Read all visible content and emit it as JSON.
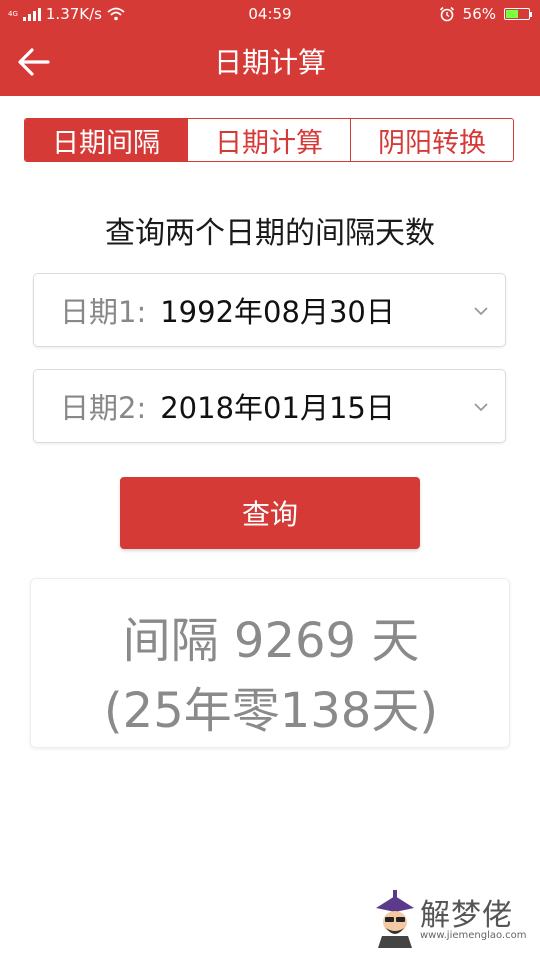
{
  "status_bar": {
    "network": "4G",
    "speed": "1.37K/s",
    "time": "04:59",
    "battery_percent": "56%",
    "battery_level": 0.56,
    "icons": [
      "signal-icon",
      "wifi-icon",
      "alarm-icon",
      "battery-icon"
    ]
  },
  "header": {
    "title": "日期计算",
    "back_icon": "arrow-left-icon"
  },
  "tabs": [
    {
      "label": "日期间隔",
      "active": true
    },
    {
      "label": "日期计算",
      "active": false
    },
    {
      "label": "阴阳转换",
      "active": false
    }
  ],
  "subtitle": "查询两个日期的间隔天数",
  "date1": {
    "label": "日期1:",
    "value": "1992年08月30日"
  },
  "date2": {
    "label": "日期2:",
    "value": "2018年01月15日"
  },
  "query_button": "查询",
  "result": {
    "line1": "间隔 9269 天",
    "line2": "(25年零138天)"
  },
  "watermark": {
    "name": "解梦佬",
    "url": "www.jiemenglao.com"
  },
  "colors": {
    "accent": "#d63a37",
    "result_text": "#8a8a8a",
    "label_text": "#888888"
  }
}
